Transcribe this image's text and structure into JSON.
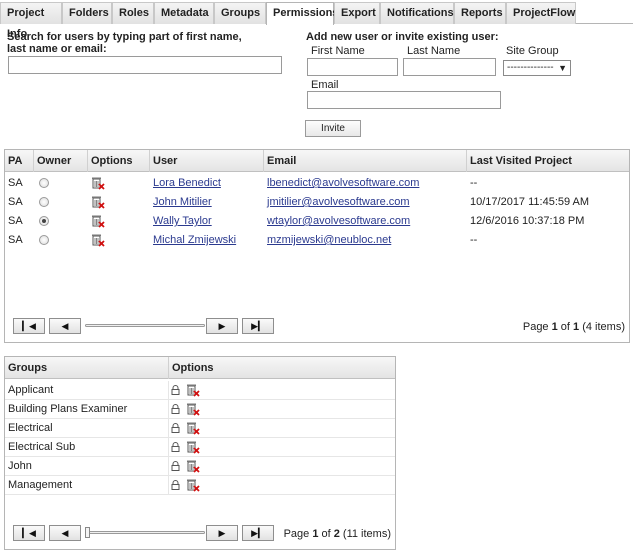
{
  "tabs": [
    {
      "label": "Project Info",
      "active": false
    },
    {
      "label": "Folders",
      "active": false
    },
    {
      "label": "Roles",
      "active": false
    },
    {
      "label": "Metadata",
      "active": false
    },
    {
      "label": "Groups",
      "active": false
    },
    {
      "label": "Permissions",
      "active": true
    },
    {
      "label": "Export",
      "active": false
    },
    {
      "label": "Notifications",
      "active": false
    },
    {
      "label": "Reports",
      "active": false
    },
    {
      "label": "ProjectFlow",
      "active": false
    }
  ],
  "search": {
    "label_line1": "Search for users by typing part of first name,",
    "label_line2": "last name or email:",
    "value": ""
  },
  "invite": {
    "heading": "Add new user or invite existing user:",
    "first_name_label": "First Name",
    "last_name_label": "Last Name",
    "site_group_label": "Site Group",
    "site_group_value": "--------------",
    "email_label": "Email",
    "button_label": "Invite"
  },
  "users_table": {
    "headers": [
      "PA",
      "Owner",
      "Options",
      "User",
      "Email",
      "Last Visited Project"
    ],
    "rows": [
      {
        "pa": "SA",
        "owner": false,
        "user": "Lora Benedict",
        "email": "lbenedict@avolvesoftware.com",
        "last": "--"
      },
      {
        "pa": "SA",
        "owner": false,
        "user": "John Mitilier",
        "email": "jmitilier@avolvesoftware.com",
        "last": "10/17/2017 11:45:59 AM"
      },
      {
        "pa": "SA",
        "owner": true,
        "user": "Wally Taylor",
        "email": "wtaylor@avolvesoftware.com",
        "last": "12/6/2016 10:37:18 PM"
      },
      {
        "pa": "SA",
        "owner": false,
        "user": "Michal Zmijewski",
        "email": "mzmijewski@neubloc.net",
        "last": "--"
      }
    ],
    "pager": {
      "prefix": "Page ",
      "page": "1",
      "of": " of ",
      "total": "1",
      "items": " (4 items)"
    }
  },
  "groups_table": {
    "headers": [
      "Groups",
      "Options"
    ],
    "rows": [
      "Applicant",
      "Building Plans Examiner",
      "Electrical",
      "Electrical Sub",
      "John",
      "Management"
    ],
    "pager": {
      "prefix": "Page ",
      "page": "1",
      "of": " of ",
      "total": "2",
      "items": " (11 items)"
    }
  },
  "icons": {
    "first": "first-page-icon",
    "prev": "prev-page-icon",
    "next": "next-page-icon",
    "last": "last-page-icon",
    "delete": "trash-delete-icon",
    "lock": "lock-icon"
  },
  "colors": {
    "link": "#2b3a8f",
    "delete_x": "#d01010"
  }
}
